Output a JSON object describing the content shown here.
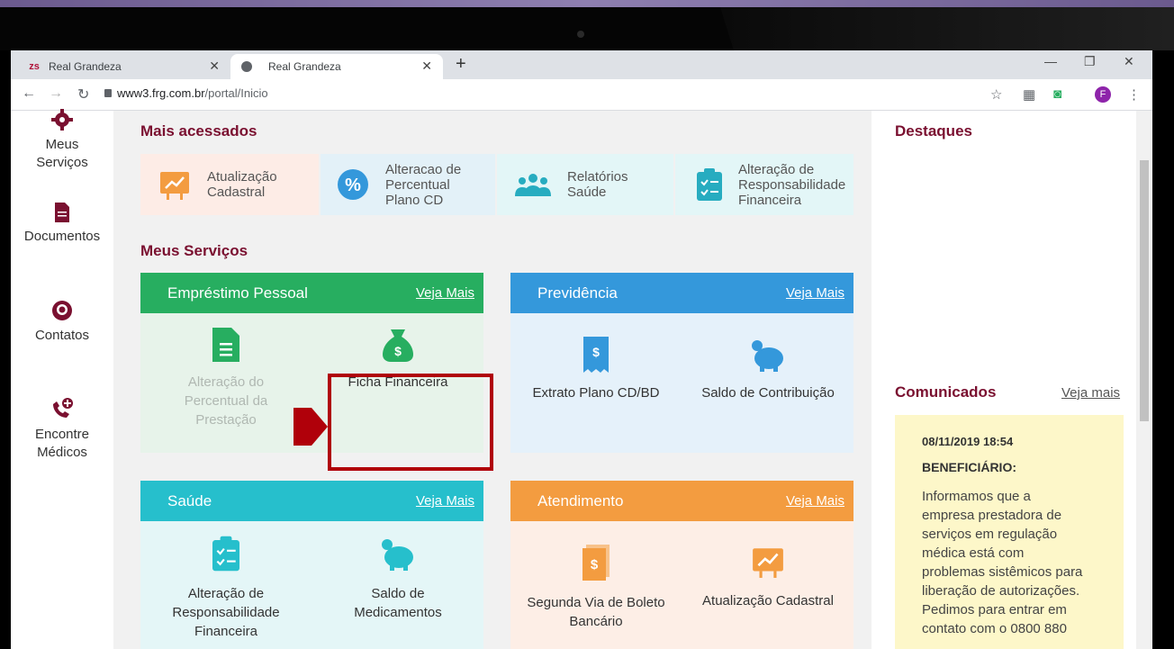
{
  "browser": {
    "tabs": [
      {
        "favicon": "zs",
        "title": "Real Grandeza"
      },
      {
        "title": "Real Grandeza"
      }
    ],
    "url_host": "www3.frg.com.br",
    "url_path": "/portal/Inicio",
    "profile_initial": "F"
  },
  "sidebar": {
    "items": [
      {
        "label1": "Meus",
        "label2": "Serviços"
      },
      {
        "label1": "Documentos",
        "label2": ""
      },
      {
        "label1": "Contatos",
        "label2": ""
      },
      {
        "label1": "Encontre",
        "label2": "Médicos"
      }
    ]
  },
  "main": {
    "most_accessed_title": "Mais acessados",
    "shortcuts": [
      {
        "l1": "Atualização",
        "l2": "Cadastral",
        "l3": ""
      },
      {
        "l1": "Alteracao de",
        "l2": "Percentual",
        "l3": "Plano CD"
      },
      {
        "l1": "Relatórios",
        "l2": "Saúde",
        "l3": ""
      },
      {
        "l1": "Alteração de",
        "l2": "Responsabilidade",
        "l3": "Financeira"
      }
    ],
    "services_title": "Meus Serviços",
    "boxes": [
      {
        "title": "Empréstimo Pessoal",
        "link": "Veja Mais",
        "color": "#27ae60",
        "items": [
          {
            "l1": "Alteração do",
            "l2": "Percentual da",
            "l3": "Prestação"
          },
          {
            "l1": "Ficha Financeira",
            "l2": "",
            "l3": ""
          }
        ]
      },
      {
        "title": "Previdência",
        "link": "Veja Mais",
        "color": "#3498db",
        "items": [
          {
            "l1": "Extrato Plano CD/BD",
            "l2": "",
            "l3": ""
          },
          {
            "l1": "Saldo de Contribuição",
            "l2": "",
            "l3": ""
          }
        ]
      },
      {
        "title": "Saúde",
        "link": "Veja Mais",
        "color": "#26bfcc",
        "items": [
          {
            "l1": "Alteração de",
            "l2": "Responsabilidade",
            "l3": "Financeira"
          },
          {
            "l1": "Saldo de",
            "l2": "Medicamentos",
            "l3": ""
          }
        ]
      },
      {
        "title": "Atendimento",
        "link": "Veja Mais",
        "color": "#f39c40",
        "items": [
          {
            "l1": "Segunda Via de Boleto",
            "l2": "Bancário",
            "l3": ""
          },
          {
            "l1": "Atualização Cadastral",
            "l2": "",
            "l3": ""
          }
        ]
      }
    ]
  },
  "right": {
    "highlights_title": "Destaques",
    "notices_title": "Comunicados",
    "notices_link": "Veja mais",
    "notice": {
      "date": "08/11/2019 18:54",
      "heading": "BENEFICIÁRIO:",
      "lines": [
        "Informamos que a",
        "empresa prestadora de",
        "serviços em regulação",
        "médica está com",
        "problemas sistêmicos para",
        "liberação de autorizações.",
        "Pedimos para entrar em",
        "contato com o 0800 880"
      ]
    }
  }
}
